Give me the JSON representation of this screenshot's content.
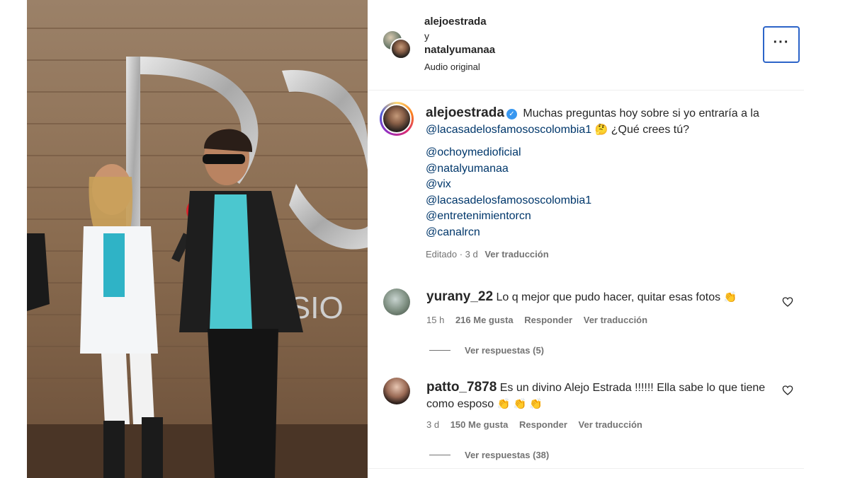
{
  "post": {
    "header": {
      "user1": "alejoestrada",
      "joiner": "y",
      "user2": "natalyumanaa",
      "audio": "Audio original"
    },
    "caption": {
      "username": "alejoestrada",
      "text_part1": "Muchas preguntas hoy sobre si yo entraría a la",
      "mention_main": "@lacasadelosfamososcolombia1",
      "emoji": "🤔",
      "text_part2": "¿Qué crees tú?",
      "mentions": [
        "@ochoymedioficial",
        "@natalyumanaa",
        "@vix",
        "@lacasadelosfamososcolombia1",
        "@entretenimientorcn",
        "@canalrcn"
      ],
      "meta_edited": "Editado · 3 d",
      "meta_translate": "Ver traducción"
    },
    "comments": [
      {
        "username": "yurany_22",
        "text": "Lo q mejor que pudo hacer, quitar esas fotos",
        "emoji": "👏",
        "time": "15 h",
        "likes": "216 Me gusta",
        "reply": "Responder",
        "translate": "Ver traducción",
        "replies": "Ver respuestas (5)"
      },
      {
        "username": "patto_7878",
        "text": "Es un divino Alejo Estrada !!!!!! Ella sabe lo que tiene como esposo",
        "emoji": "👏 👏 👏",
        "time": "3 d",
        "likes": "150 Me gusta",
        "reply": "Responder",
        "translate": "Ver traducción",
        "replies": "Ver respuestas (38)"
      }
    ],
    "colors": {
      "link": "#00376b",
      "muted": "#737373",
      "focus_border": "#2c64c8",
      "verified": "#3897f0"
    }
  }
}
